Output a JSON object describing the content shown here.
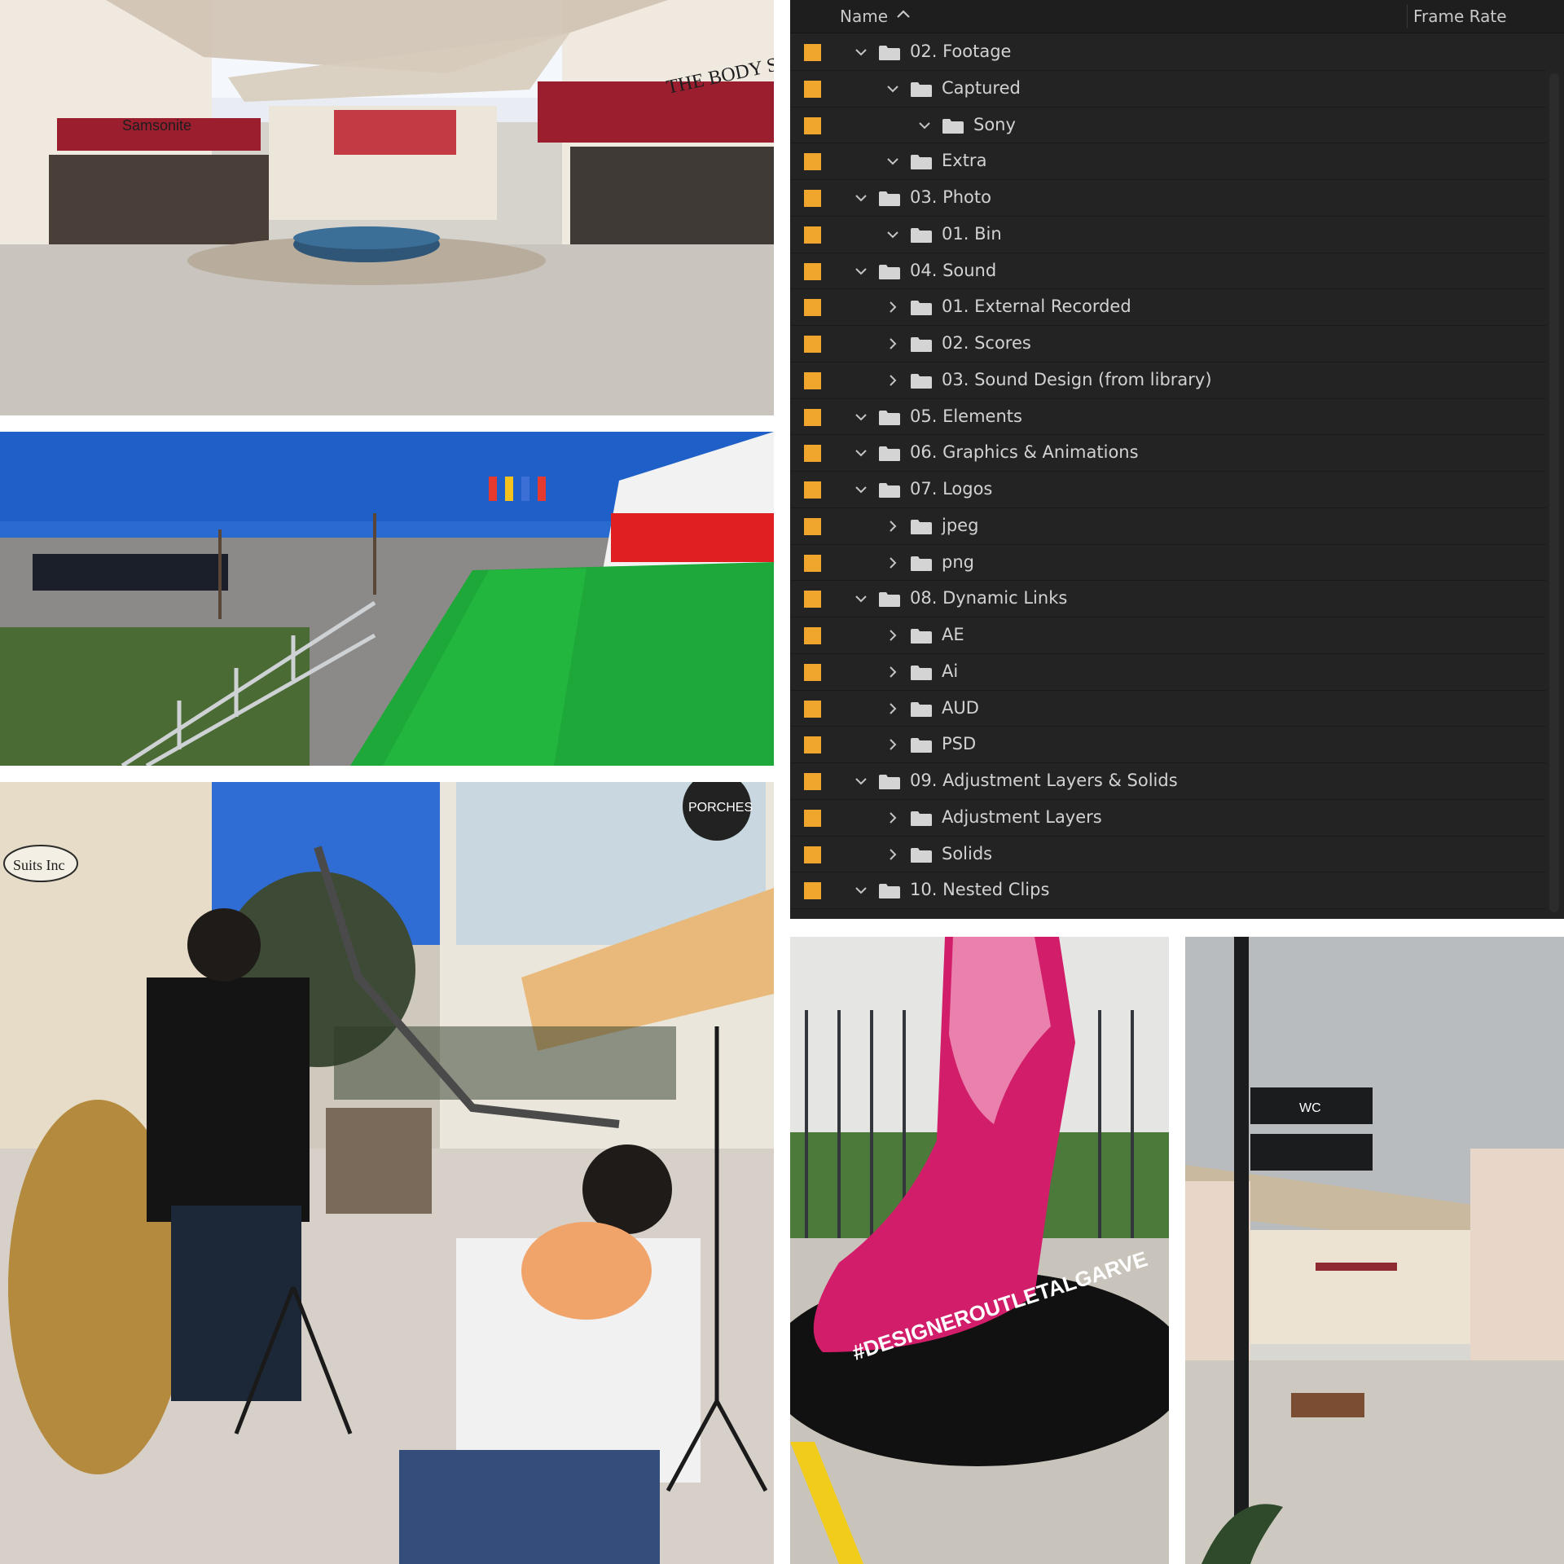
{
  "photos": [
    {
      "id": "outlet-plaza",
      "shop_signs": [
        "THE BODY SHOP",
        "Samsonite",
        "THE BODY SHOP"
      ]
    },
    {
      "id": "green-carpet-event",
      "shop_signs": []
    },
    {
      "id": "photo-shoot",
      "shop_signs": [
        "Suits Inc",
        "PORCHES"
      ]
    },
    {
      "id": "red-shoe",
      "shop_signs": [
        "#DESIGNEROUTLETALGARVE"
      ]
    },
    {
      "id": "wc-signpost",
      "shop_signs": [
        "WC"
      ]
    }
  ],
  "panel": {
    "header": {
      "name": "Name",
      "frame_rate": "Frame Rate"
    },
    "label_color": "#f0a52c",
    "rows": [
      {
        "label": "02. Footage",
        "depth": 0,
        "expanded": true
      },
      {
        "label": "Captured",
        "depth": 1,
        "expanded": true
      },
      {
        "label": "Sony",
        "depth": 2,
        "expanded": true
      },
      {
        "label": "Extra",
        "depth": 1,
        "expanded": true
      },
      {
        "label": "03. Photo",
        "depth": 0,
        "expanded": true
      },
      {
        "label": "01. Bin",
        "depth": 1,
        "expanded": true
      },
      {
        "label": "04. Sound",
        "depth": 0,
        "expanded": true
      },
      {
        "label": "01. External Recorded",
        "depth": 1,
        "expanded": false
      },
      {
        "label": "02. Scores",
        "depth": 1,
        "expanded": false
      },
      {
        "label": "03. Sound Design (from library)",
        "depth": 1,
        "expanded": false
      },
      {
        "label": "05. Elements",
        "depth": 0,
        "expanded": true
      },
      {
        "label": "06. Graphics & Animations",
        "depth": 0,
        "expanded": true
      },
      {
        "label": "07. Logos",
        "depth": 0,
        "expanded": true
      },
      {
        "label": "jpeg",
        "depth": 1,
        "expanded": false
      },
      {
        "label": "png",
        "depth": 1,
        "expanded": false
      },
      {
        "label": "08. Dynamic Links",
        "depth": 0,
        "expanded": true
      },
      {
        "label": "AE",
        "depth": 1,
        "expanded": false
      },
      {
        "label": "Ai",
        "depth": 1,
        "expanded": false
      },
      {
        "label": "AUD",
        "depth": 1,
        "expanded": false
      },
      {
        "label": "PSD",
        "depth": 1,
        "expanded": false
      },
      {
        "label": "09. Adjustment Layers & Solids",
        "depth": 0,
        "expanded": true
      },
      {
        "label": "Adjustment Layers",
        "depth": 1,
        "expanded": false
      },
      {
        "label": "Solids",
        "depth": 1,
        "expanded": false
      },
      {
        "label": "10. Nested Clips",
        "depth": 0,
        "expanded": true
      }
    ]
  }
}
